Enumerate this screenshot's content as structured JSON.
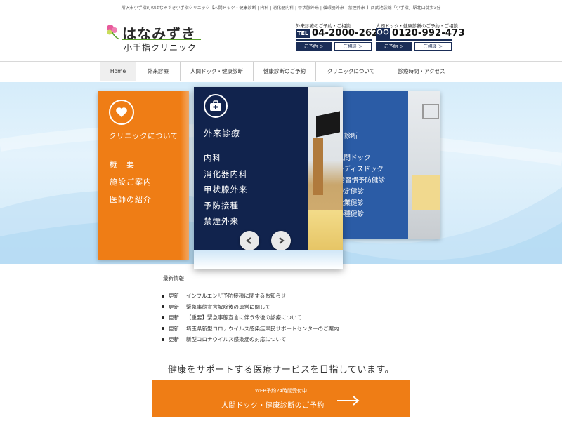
{
  "header": {
    "topline": "所沢市小手指町のはなみずき小手指クリニック【人間ドック・健康診断 | 内科 | 消化器内科 | 甲状腺外来 | 循環器外来 | 禁煙外来 】西武池袋線「小手指」駅北口徒歩3分",
    "logo": {
      "name_main": "はなみずき",
      "name_sub": "小手指クリニック"
    },
    "contacts": [
      {
        "label": "外来診療のご予約・ご相談",
        "badge": "TEL",
        "number": "04-2000-2621",
        "buttons": [
          "ご予約 ＞",
          "ご相談 ＞"
        ]
      },
      {
        "label": "人間ドック・健康診断のご予約・ご相談",
        "badge": "0120",
        "number": "0120-992-473",
        "buttons": [
          "ご予約 ＞",
          "ご相談 ＞"
        ]
      }
    ]
  },
  "nav": {
    "items": [
      "Home",
      "外来診療",
      "人間ドック・健康診断",
      "健康診断のご予約",
      "クリニックについて",
      "診療時間・アクセス"
    ],
    "active": "Home"
  },
  "hero": {
    "left": {
      "icon": "heart-icon",
      "title": "クリニックについて",
      "items": [
        "概　要",
        "施設ご案内",
        "医師の紹介"
      ]
    },
    "center": {
      "icon": "medical-bag-icon",
      "title": "外来診療",
      "items": [
        "内科",
        "消化器内科",
        "甲状腺外来",
        "予防接種",
        "禁煙外来"
      ]
    },
    "right": {
      "title": "診断",
      "items": [
        "人間ドック",
        "レディスドック",
        "生活習慣予防健診",
        "特定健診",
        "企業健診",
        "各種健診"
      ]
    },
    "colors": {
      "orange": "#ef7d15",
      "navy": "#11234d",
      "blue": "#2b5ca6"
    }
  },
  "news": {
    "heading": "最新情報",
    "items": [
      {
        "tag": "更新",
        "text": "インフルエンザ予防接種に関するお知らせ"
      },
      {
        "tag": "更新",
        "text": "緊急事態宣言解除後の運営に関して"
      },
      {
        "tag": "更新",
        "text": "【重要】緊急事態宣言に伴う今後の診療について"
      },
      {
        "tag": "更新",
        "text": "埼玉県新型コロナウイルス感染症県民サポートセンターのご案内"
      },
      {
        "tag": "更新",
        "text": "新型コロナウイルス感染症の対応について"
      }
    ]
  },
  "tagline": "健康をサポートする医療サービスを目指しています。",
  "cta": {
    "small": "WEB予約24時間受付中",
    "main": "人間ドック・健康診断のご予約"
  }
}
